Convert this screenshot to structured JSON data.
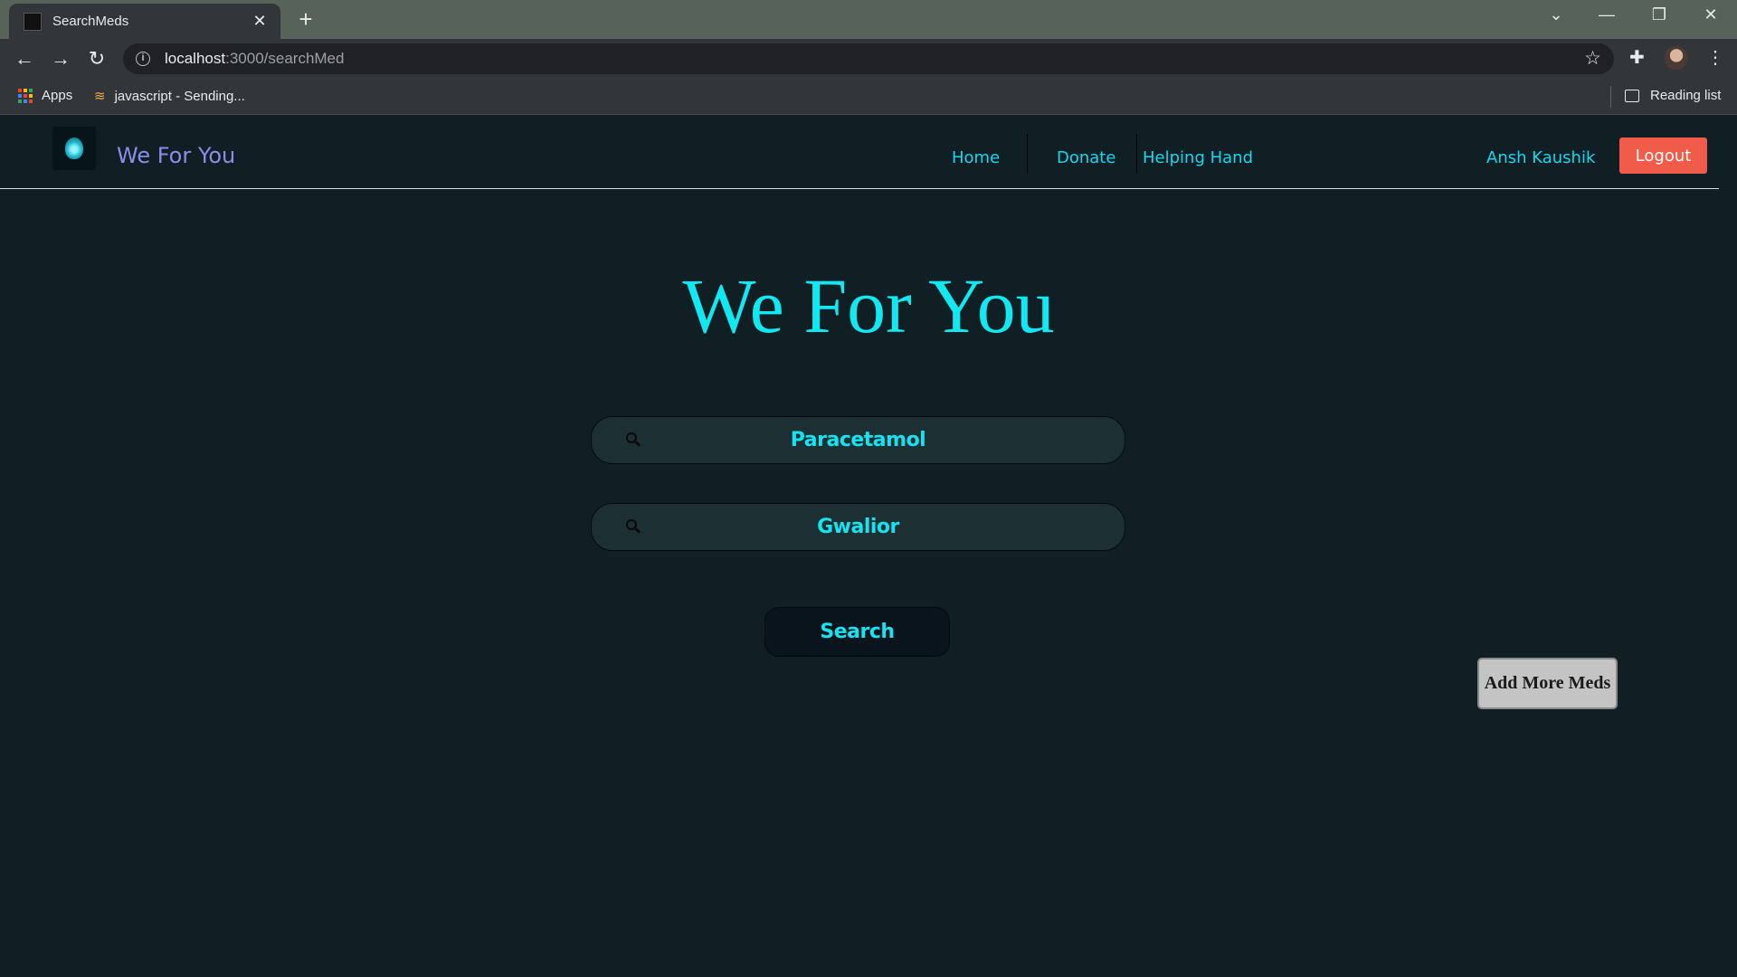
{
  "browser": {
    "tab_title": "SearchMeds",
    "url_host": "localhost",
    "url_rest": ":3000/searchMed",
    "bookmarks": [
      {
        "label": "Apps"
      },
      {
        "label": "javascript - Sending..."
      }
    ],
    "reading_list_label": "Reading list"
  },
  "site": {
    "brand": "We For You",
    "nav": [
      "Home",
      "Donate",
      "Helping Hand"
    ],
    "user_name": "Ansh Kaushik",
    "logout_label": "Logout"
  },
  "main": {
    "title": "We For You",
    "medicine_value": "Paracetamol",
    "city_value": "Gwalior",
    "search_label": "Search",
    "add_more_label": "Add More Meds"
  },
  "colors": {
    "page_bg": "#0f1f24",
    "accent_cyan": "#17d6ee",
    "logout_red": "#f05b4a",
    "brand_purple": "#8a8ee8"
  }
}
